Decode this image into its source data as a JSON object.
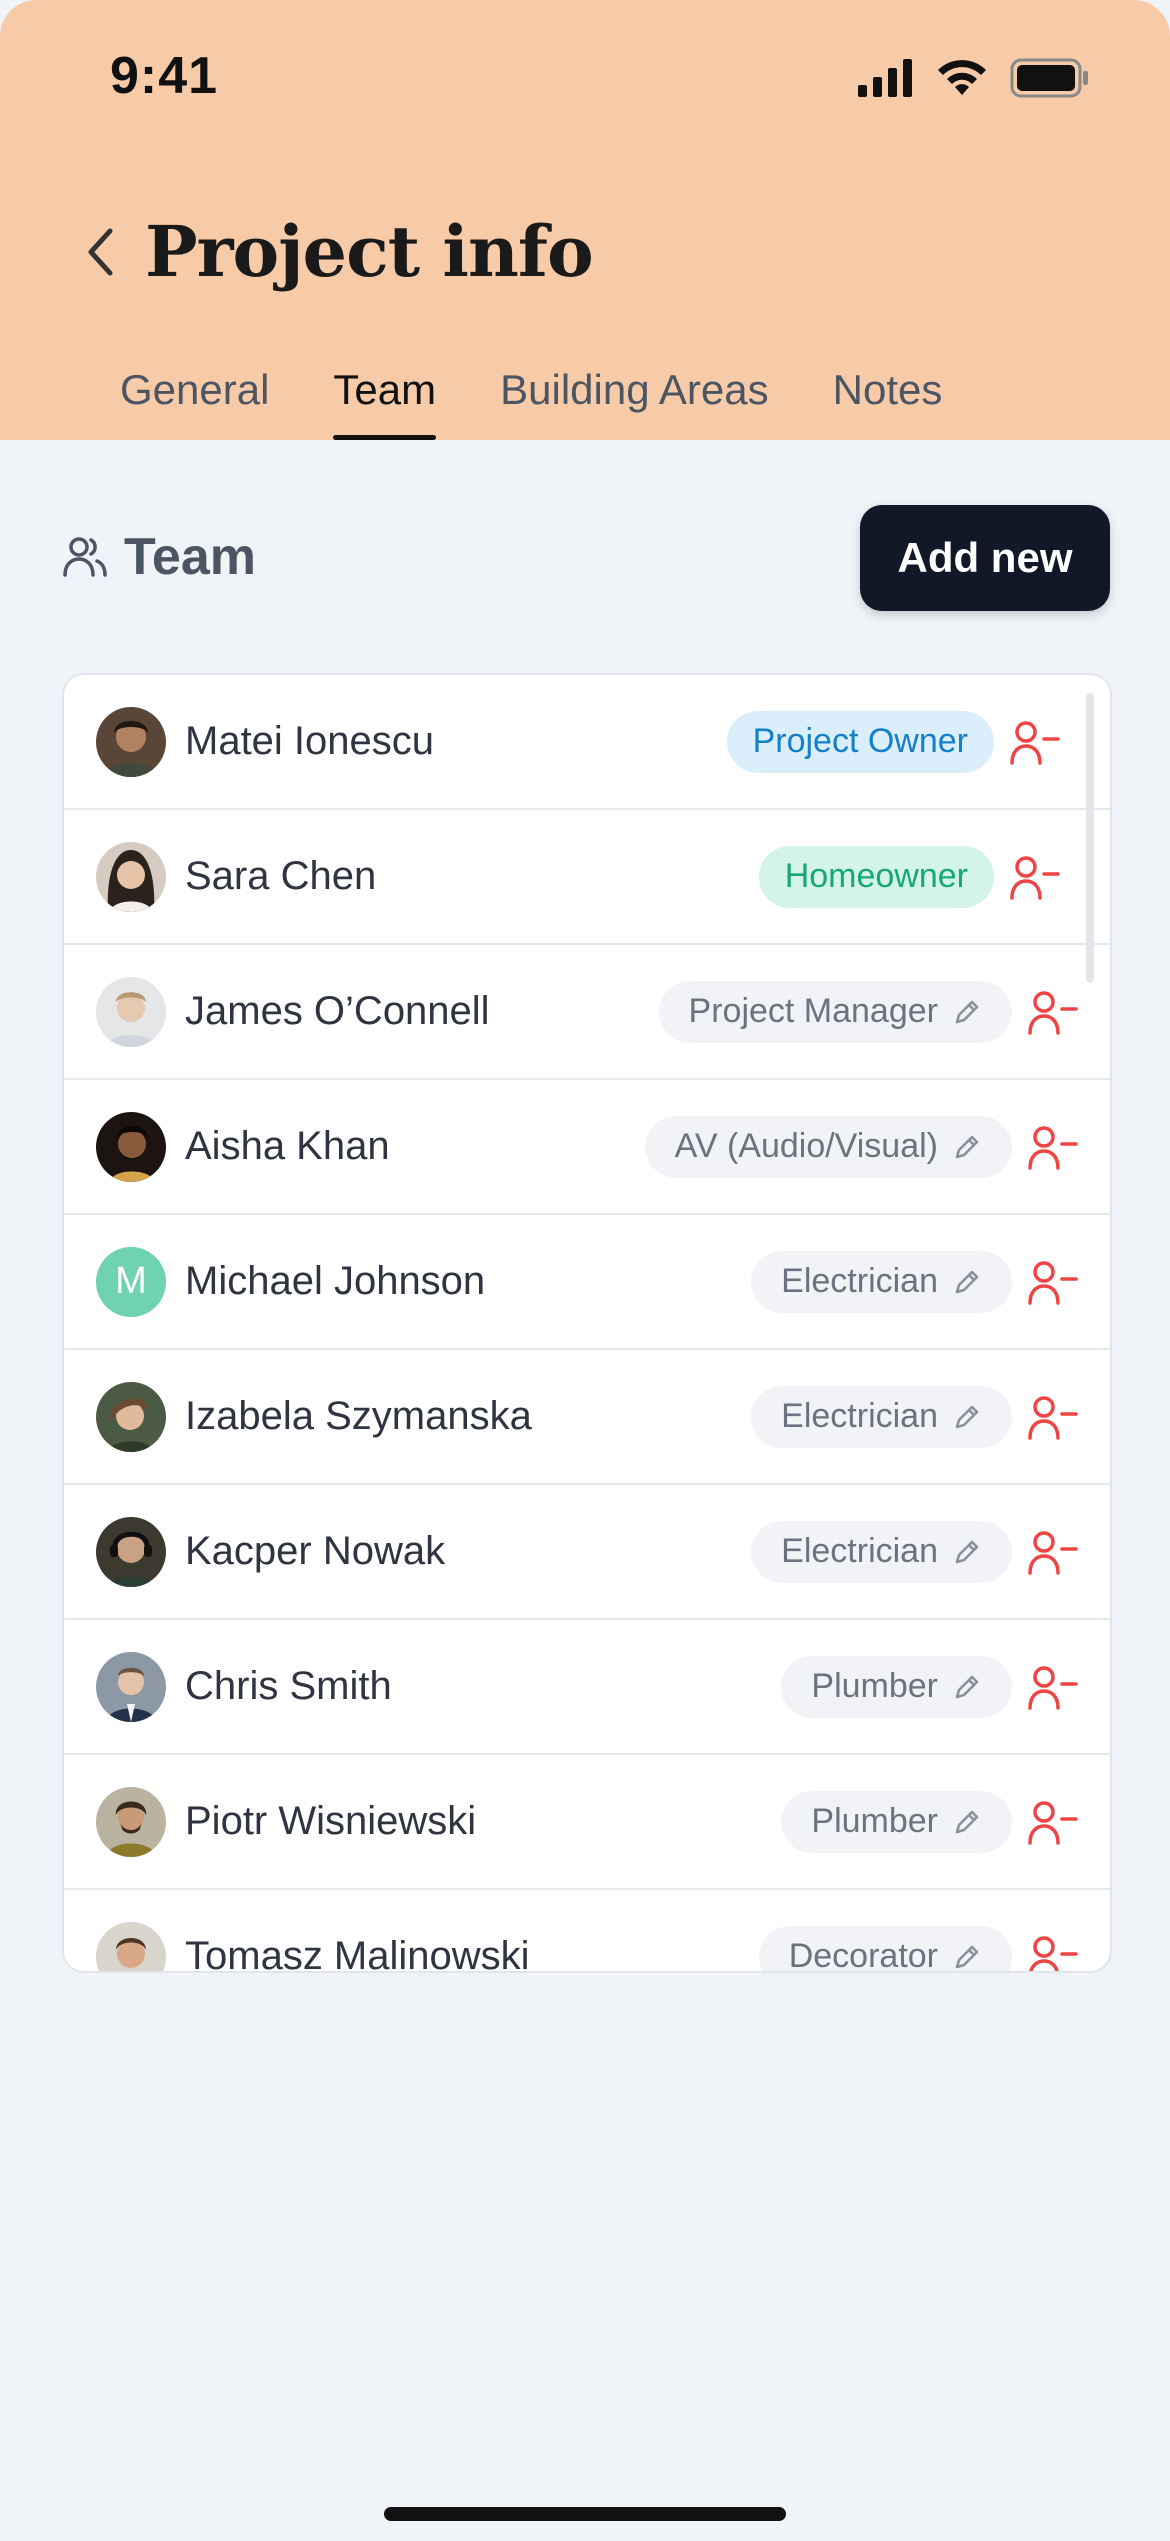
{
  "status_bar": {
    "time": "9:41"
  },
  "header": {
    "title": "Project info",
    "tabs": [
      {
        "label": "General",
        "active": false
      },
      {
        "label": "Team",
        "active": true
      },
      {
        "label": "Building Areas",
        "active": false
      },
      {
        "label": "Notes",
        "active": false
      }
    ]
  },
  "section": {
    "title": "Team",
    "add_label": "Add new"
  },
  "members": [
    {
      "name": "Matei Ionescu",
      "role": "Project Owner",
      "role_style": "owner",
      "editable": false
    },
    {
      "name": "Sara Chen",
      "role": "Homeowner",
      "role_style": "home",
      "editable": false
    },
    {
      "name": "James O’Connell",
      "role": "Project Manager",
      "role_style": "default",
      "editable": true
    },
    {
      "name": "Aisha Khan",
      "role": "AV (Audio/Visual)",
      "role_style": "default",
      "editable": true
    },
    {
      "name": "Michael Johnson",
      "role": "Electrician",
      "role_style": "default",
      "editable": true,
      "avatar_letter": "M"
    },
    {
      "name": "Izabela Szymanska",
      "role": "Electrician",
      "role_style": "default",
      "editable": true
    },
    {
      "name": "Kacper Nowak",
      "role": "Electrician",
      "role_style": "default",
      "editable": true
    },
    {
      "name": "Chris Smith",
      "role": "Plumber",
      "role_style": "default",
      "editable": true
    },
    {
      "name": "Piotr Wisniewski",
      "role": "Plumber",
      "role_style": "default",
      "editable": true
    },
    {
      "name": "Tomasz Malinowski",
      "role": "Decorator",
      "role_style": "default",
      "editable": true
    }
  ],
  "icons": {
    "back": "chevron-left-icon",
    "team": "users-icon",
    "remove": "user-minus-icon",
    "edit": "pencil-icon"
  },
  "colors": {
    "header_bg": "#f8cba8",
    "remove_red": "#ef4444",
    "owner_badge_bg": "#dbeefc",
    "owner_badge_text": "#1380c8",
    "homeowner_badge_bg": "#d3f4e6",
    "homeowner_badge_text": "#16a77a",
    "button_bg": "#111827"
  }
}
